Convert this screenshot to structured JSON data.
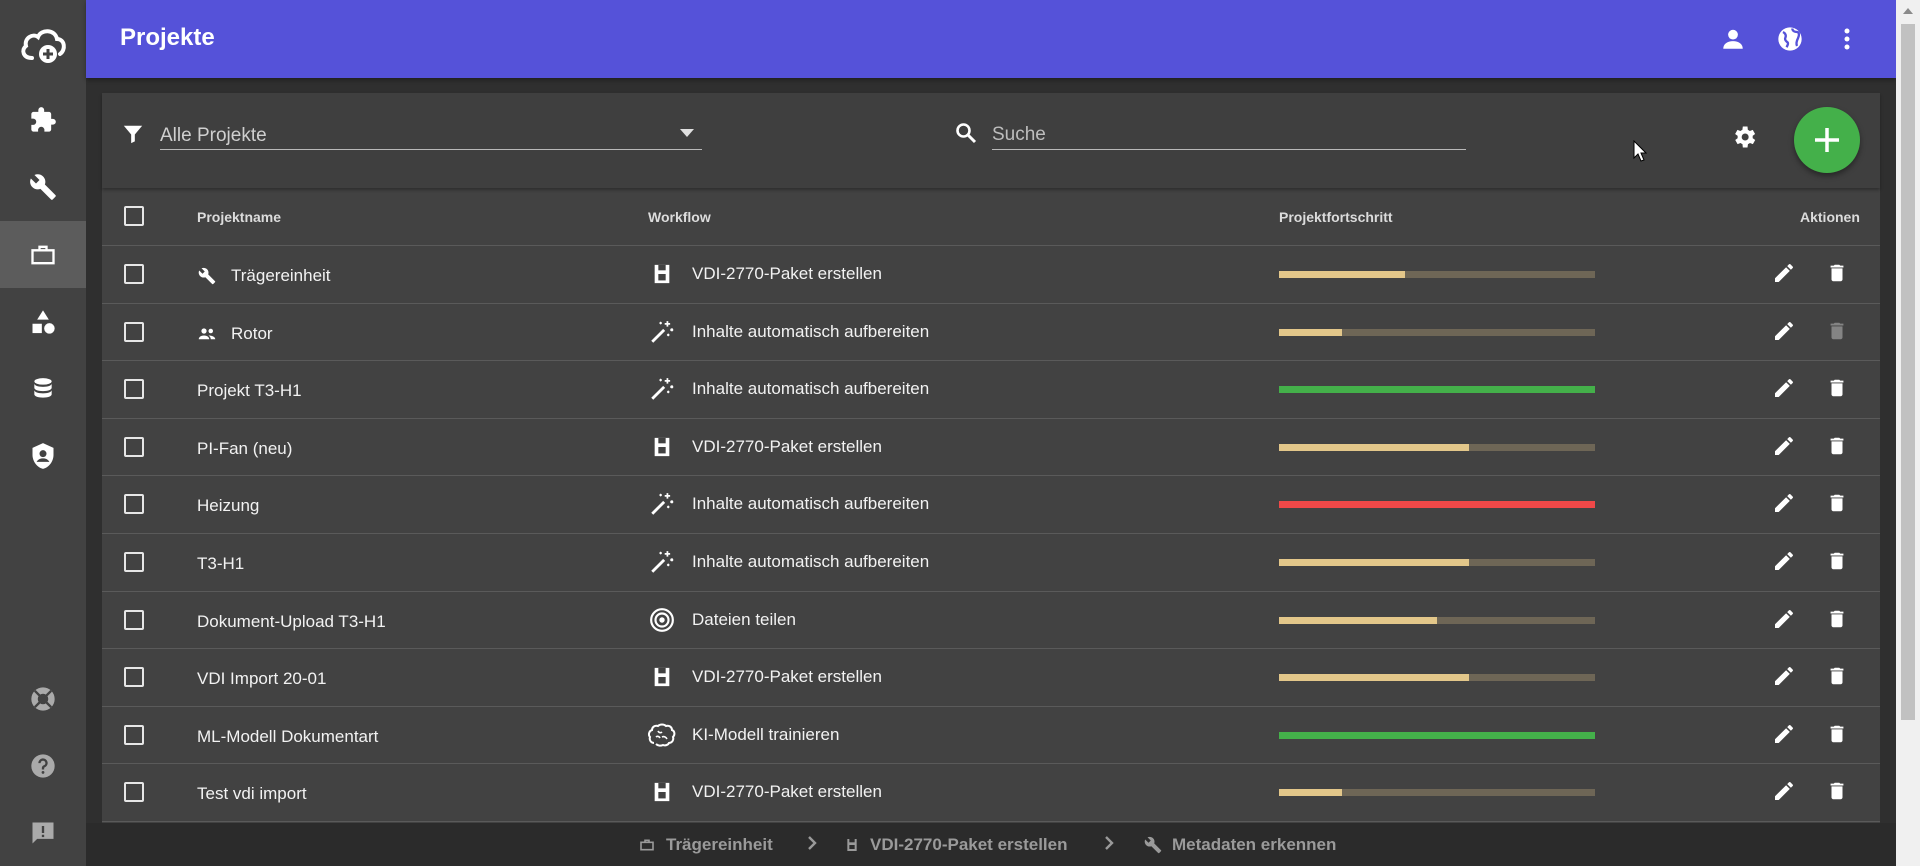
{
  "header": {
    "title": "Projekte"
  },
  "toolbar": {
    "filter_value": "Alle Projekte",
    "search_placeholder": "Suche"
  },
  "table": {
    "columns": {
      "name": "Projektname",
      "workflow": "Workflow",
      "progress": "Projektfortschritt",
      "actions": "Aktionen"
    },
    "rows": [
      {
        "name": "Trägereinheit",
        "name_icon": "wrench-icon",
        "workflow": "VDI-2770-Paket erstellen",
        "workflow_icon": "package-icon",
        "progress": 0.4,
        "status": "in-progress",
        "delete_enabled": true
      },
      {
        "name": "Rotor",
        "name_icon": "people-icon",
        "workflow": "Inhalte automatisch aufbereiten",
        "workflow_icon": "magic-wand-icon",
        "progress": 0.2,
        "status": "in-progress",
        "delete_enabled": false
      },
      {
        "name": "Projekt T3-H1",
        "name_icon": "",
        "workflow": "Inhalte automatisch aufbereiten",
        "workflow_icon": "magic-wand-icon",
        "progress": 1.0,
        "status": "done",
        "delete_enabled": true
      },
      {
        "name": "PI-Fan (neu)",
        "name_icon": "",
        "workflow": "VDI-2770-Paket erstellen",
        "workflow_icon": "package-icon",
        "progress": 0.6,
        "status": "in-progress",
        "delete_enabled": true
      },
      {
        "name": "Heizung",
        "name_icon": "",
        "workflow": "Inhalte automatisch aufbereiten",
        "workflow_icon": "magic-wand-icon",
        "progress": 1.0,
        "status": "error",
        "delete_enabled": true
      },
      {
        "name": "T3-H1",
        "name_icon": "",
        "workflow": "Inhalte automatisch aufbereiten",
        "workflow_icon": "magic-wand-icon",
        "progress": 0.6,
        "status": "in-progress",
        "delete_enabled": true
      },
      {
        "name": "Dokument-Upload T3-H1",
        "name_icon": "",
        "workflow": "Dateien teilen",
        "workflow_icon": "target-icon",
        "progress": 0.5,
        "status": "in-progress",
        "delete_enabled": true
      },
      {
        "name": "VDI Import 20-01",
        "name_icon": "",
        "workflow": "VDI-2770-Paket erstellen",
        "workflow_icon": "package-icon",
        "progress": 0.6,
        "status": "in-progress",
        "delete_enabled": true
      },
      {
        "name": "ML-Modell Dokumentart",
        "name_icon": "",
        "workflow": "KI-Modell trainieren",
        "workflow_icon": "brain-icon",
        "progress": 1.0,
        "status": "done",
        "delete_enabled": true
      },
      {
        "name": "Test vdi import",
        "name_icon": "",
        "workflow": "VDI-2770-Paket erstellen",
        "workflow_icon": "package-icon",
        "progress": 0.2,
        "status": "in-progress",
        "delete_enabled": true
      }
    ]
  },
  "breadcrumb": [
    {
      "label": "Trägereinheit",
      "icon": "briefcase-icon"
    },
    {
      "label": "VDI-2770-Paket erstellen",
      "icon": "package-icon"
    },
    {
      "label": "Metadaten erkennen",
      "icon": "wrench-icon"
    }
  ],
  "colors": {
    "header": "#5552d9",
    "progress_in": "#e3c78a",
    "progress_track": "#6e6656",
    "progress_done": "#44b04a",
    "progress_error": "#ef4848",
    "fab": "#44b04a"
  }
}
